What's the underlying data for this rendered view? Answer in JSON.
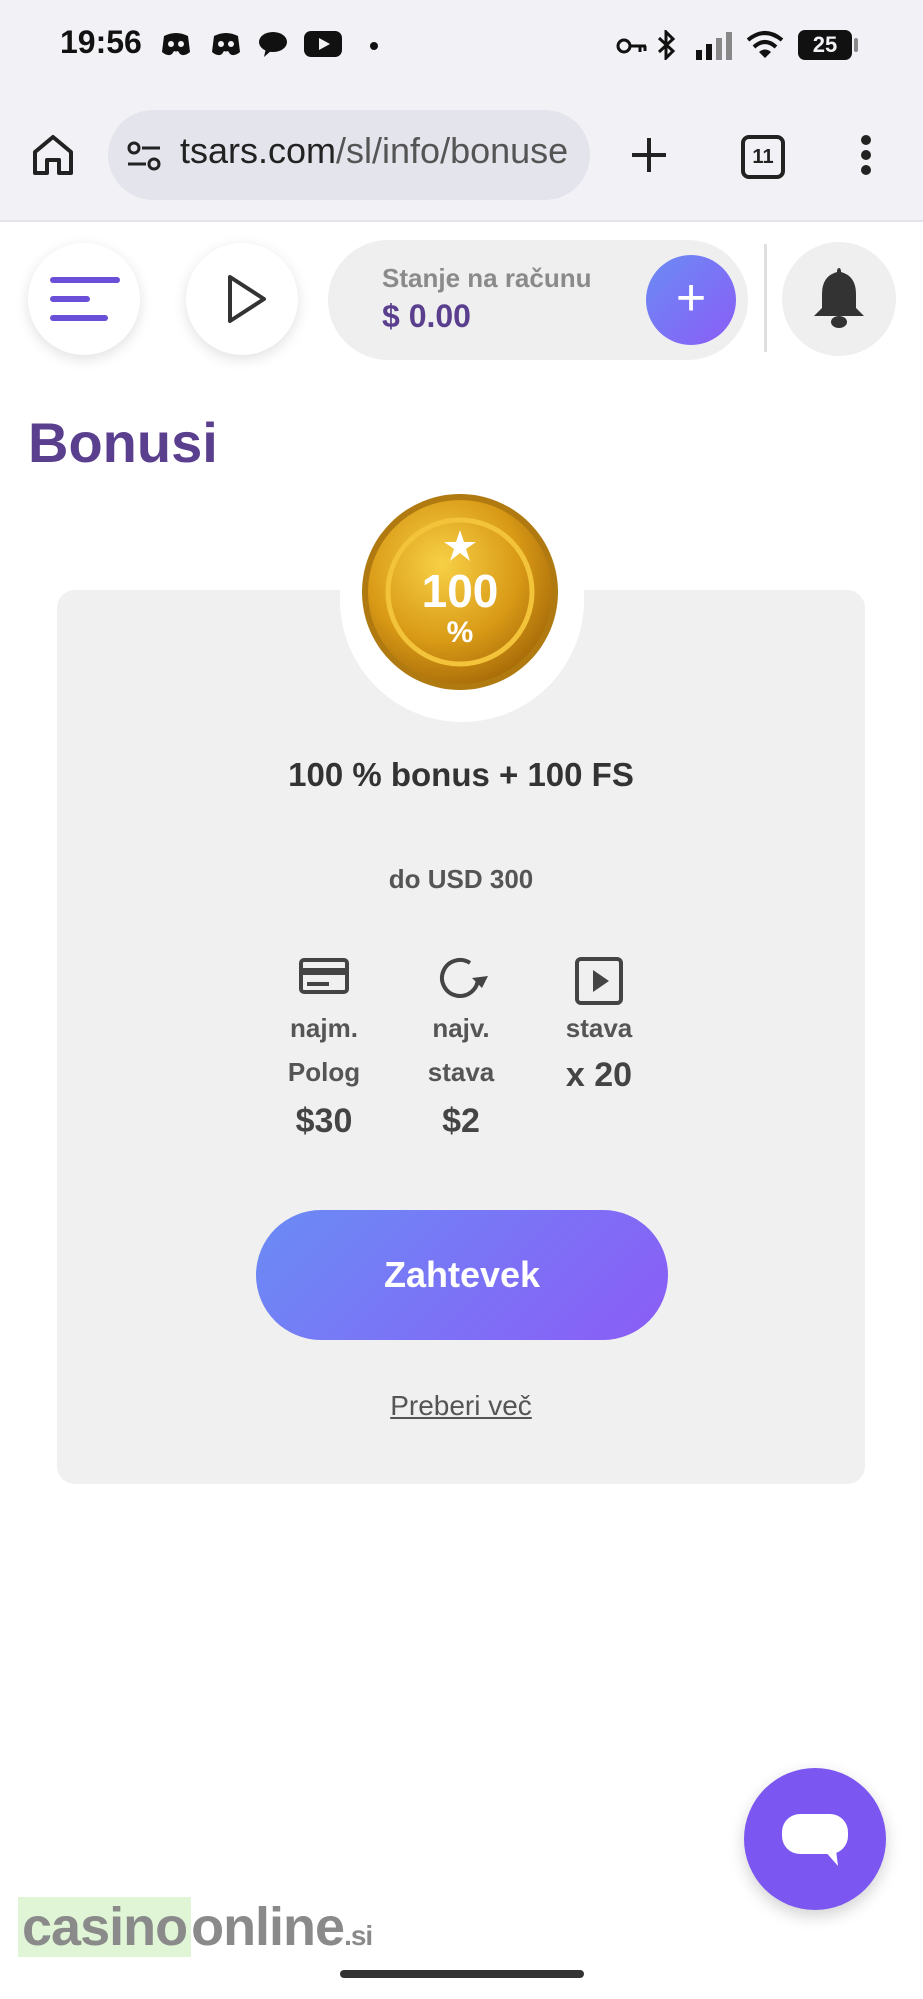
{
  "status_bar": {
    "time": "19:56",
    "left_icons": [
      "discord-icon",
      "discord-icon",
      "chat-bubble-icon",
      "youtube-icon",
      "dot-icon"
    ],
    "right_icons": [
      "key-icon",
      "bluetooth-icon",
      "signal-icon",
      "wifi-icon",
      "battery-icon"
    ],
    "battery_level": "25"
  },
  "browser": {
    "url_visible": "tsars.com",
    "url_path": "/sl/info/bonuse",
    "tab_count": "11"
  },
  "header": {
    "balance_label": "Stanje na računu",
    "balance_value": "$ 0.00"
  },
  "page": {
    "title": "Bonusi"
  },
  "bonus_card": {
    "badge_number": "100",
    "badge_percent": "%",
    "title": "100 % bonus + 100 FS",
    "subtitle": "do USD 300",
    "stats": [
      {
        "icon": "credit-card-icon",
        "label_line1": "najm.",
        "label_line2": "Polog",
        "value": "$30"
      },
      {
        "icon": "refresh-icon",
        "label_line1": "najv.",
        "label_line2": "stava",
        "value": "$2"
      },
      {
        "icon": "play-square-icon",
        "label_line1": "stava",
        "label_line2": "",
        "value": "x 20"
      }
    ],
    "claim_label": "Zahtevek",
    "read_more_label": "Preberi več"
  },
  "watermark": {
    "part1": "casino",
    "part2": "online",
    "part3": ".si"
  },
  "colors": {
    "brand_purple": "#5b3f8f",
    "button_gradient_start": "#6a8cf5",
    "button_gradient_end": "#8b5cf6",
    "chat_button": "#7b56f0"
  }
}
